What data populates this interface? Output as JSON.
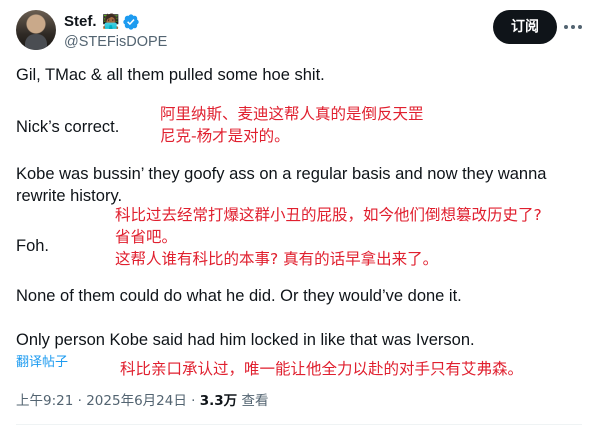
{
  "header": {
    "name": "Stef.",
    "emoji": "🧑🏾‍💻",
    "handle": "@STEFisDOPE",
    "subscribe_label": "订阅",
    "more_icon": "ellipsis-icon",
    "verified_color": "#1d9bf0"
  },
  "tweet": {
    "lines": [
      "Gil, TMac & all them pulled some hoe shit.",
      "Nick’s correct.",
      "Kobe was bussin’ they goofy ass on a regular basis and now they wanna",
      "rewrite history.",
      "Foh.",
      "None of them could do what he did. Or they would’ve done it.",
      "Only person Kobe said had him locked in like that was Iverson."
    ],
    "annotations": [
      "阿里纳斯、麦迪这帮人真的是倒反天罡",
      "尼克-杨才是对的。",
      "科比过去经常打爆这群小丑的屁股，如今他们倒想篡改历史了?",
      "省省吧。",
      "这帮人谁有科比的本事? 真有的话早拿出来了。",
      "科比亲口承认过，唯一能让他全力以赴的对手只有艾弗森。"
    ],
    "annotation_color": "#e0202f",
    "translate_label": "翻译帖子"
  },
  "meta": {
    "time": "上午9:21",
    "date": "2025年6月24日",
    "views": "3.3万",
    "views_label": "查看"
  }
}
